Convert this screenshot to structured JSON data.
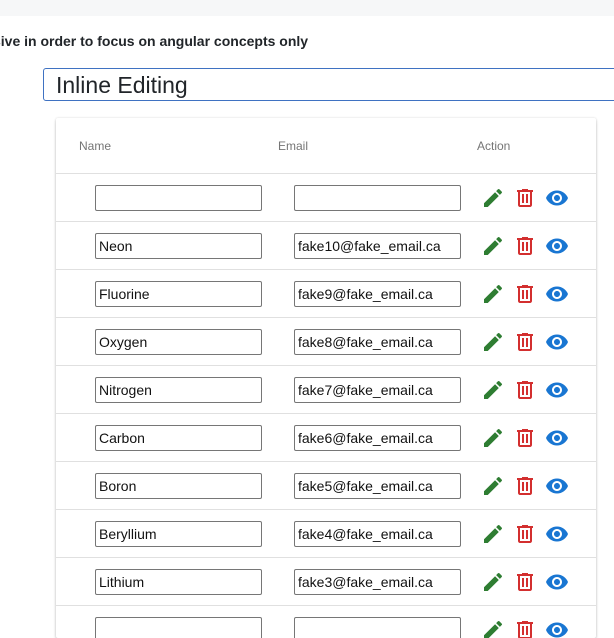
{
  "page": {
    "notice": "sive in order to focus on angular concepts only",
    "title": "Inline Editing"
  },
  "table": {
    "headers": {
      "name": "Name",
      "email": "Email",
      "action": "Action"
    },
    "rows": [
      {
        "name": "",
        "email": ""
      },
      {
        "name": "Neon",
        "email": "fake10@fake_email.ca"
      },
      {
        "name": "Fluorine",
        "email": "fake9@fake_email.ca"
      },
      {
        "name": "Oxygen",
        "email": "fake8@fake_email.ca"
      },
      {
        "name": "Nitrogen",
        "email": "fake7@fake_email.ca"
      },
      {
        "name": "Carbon",
        "email": "fake6@fake_email.ca"
      },
      {
        "name": "Boron",
        "email": "fake5@fake_email.ca"
      },
      {
        "name": "Beryllium",
        "email": "fake4@fake_email.ca"
      },
      {
        "name": "Lithium",
        "email": "fake3@fake_email.ca"
      },
      {
        "name": "",
        "email": ""
      }
    ]
  },
  "icons": {
    "edit": "pencil-icon",
    "delete": "trash-icon",
    "view": "eye-icon"
  },
  "colors": {
    "edit": "#2e7d32",
    "delete": "#d32f2f",
    "view": "#1976d2",
    "title_border": "#3f72c2"
  }
}
